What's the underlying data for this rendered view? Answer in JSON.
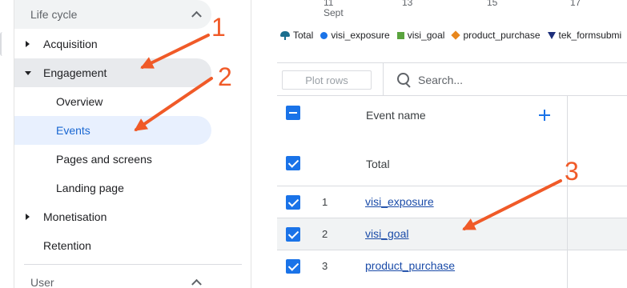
{
  "sidebar": {
    "section_lifecycle": "Life cycle",
    "items": [
      {
        "label": "Acquisition"
      },
      {
        "label": "Engagement"
      },
      {
        "label": "Overview"
      },
      {
        "label": "Events"
      },
      {
        "label": "Pages and screens"
      },
      {
        "label": "Landing page"
      },
      {
        "label": "Monetisation"
      },
      {
        "label": "Retention"
      }
    ],
    "section_user": "User"
  },
  "chart_axis": {
    "ticks": [
      "11",
      "13",
      "15",
      "17"
    ],
    "month": "Sept"
  },
  "legend": [
    {
      "label": "Total",
      "icon": "total-marker-icon",
      "color": "#1b6f8f"
    },
    {
      "label": "visi_exposure",
      "icon": "circle-marker-icon",
      "color": "#1a73e8"
    },
    {
      "label": "visi_goal",
      "icon": "square-marker-icon",
      "color": "#5aa33e"
    },
    {
      "label": "product_purchase",
      "icon": "diamond-marker-icon",
      "color": "#e8871e"
    },
    {
      "label": "tek_formsubmi",
      "icon": "triangle-marker-icon",
      "color": "#1c2e7a"
    }
  ],
  "toolbar": {
    "plot_rows_label": "Plot rows",
    "search_placeholder": "Search..."
  },
  "table": {
    "column_event_name": "Event name",
    "total_label": "Total",
    "rows": [
      {
        "num": "1",
        "event": "visi_exposure"
      },
      {
        "num": "2",
        "event": "visi_goal"
      },
      {
        "num": "3",
        "event": "product_purchase"
      }
    ]
  },
  "annotations": {
    "n1": "1",
    "n2": "2",
    "n3": "3",
    "color": "#f05a28"
  }
}
